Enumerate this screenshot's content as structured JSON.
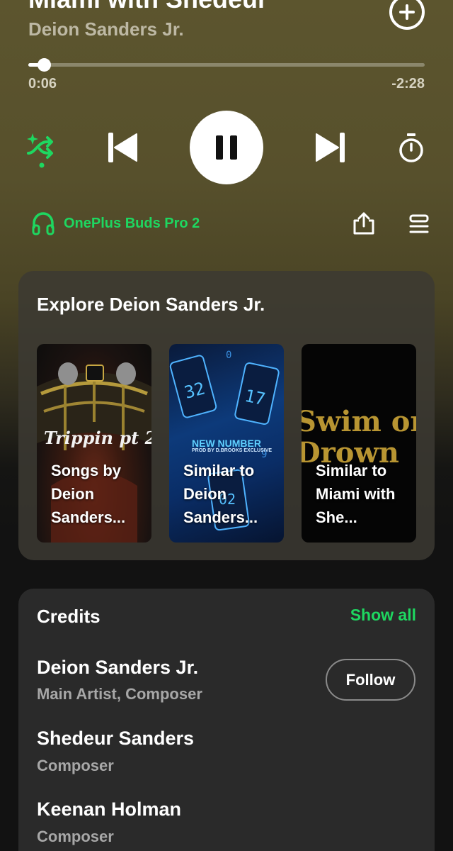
{
  "now_playing": {
    "title": "Miami with Shedeur",
    "artist": "Deion Sanders Jr."
  },
  "progress": {
    "elapsed": "0:06",
    "remaining": "-2:28",
    "fraction": 0.039
  },
  "device": {
    "name": "OnePlus Buds Pro 2"
  },
  "icons": {
    "add": "plus-circle-icon",
    "shuffle": "smart-shuffle-icon",
    "prev": "skip-previous-icon",
    "play": "pause-icon",
    "next": "skip-next-icon",
    "timer": "sleep-timer-icon",
    "device": "headphones-icon",
    "share": "share-icon",
    "queue": "queue-icon"
  },
  "colors": {
    "accent": "#1ed760",
    "background_top": "#5c552e",
    "background_bottom": "#121212"
  },
  "explore": {
    "title": "Explore Deion Sanders Jr.",
    "tiles": [
      {
        "label": "Songs by Deion Sanders...",
        "art_text": "Trippin pt 2"
      },
      {
        "label": "Similar to Deion Sanders...",
        "art_text": "NEW NUMBER",
        "art_subtext": "PROD BY D.BROOKS EXCLUSIVE"
      },
      {
        "label": "Similar to Miami with She...",
        "art_text": "Swim or Drown"
      }
    ]
  },
  "credits": {
    "title": "Credits",
    "show_all": "Show all",
    "follow_label": "Follow",
    "people": [
      {
        "name": "Deion Sanders Jr.",
        "role": "Main Artist, Composer"
      },
      {
        "name": "Shedeur Sanders",
        "role": "Composer"
      },
      {
        "name": "Keenan Holman",
        "role": "Composer"
      }
    ]
  }
}
